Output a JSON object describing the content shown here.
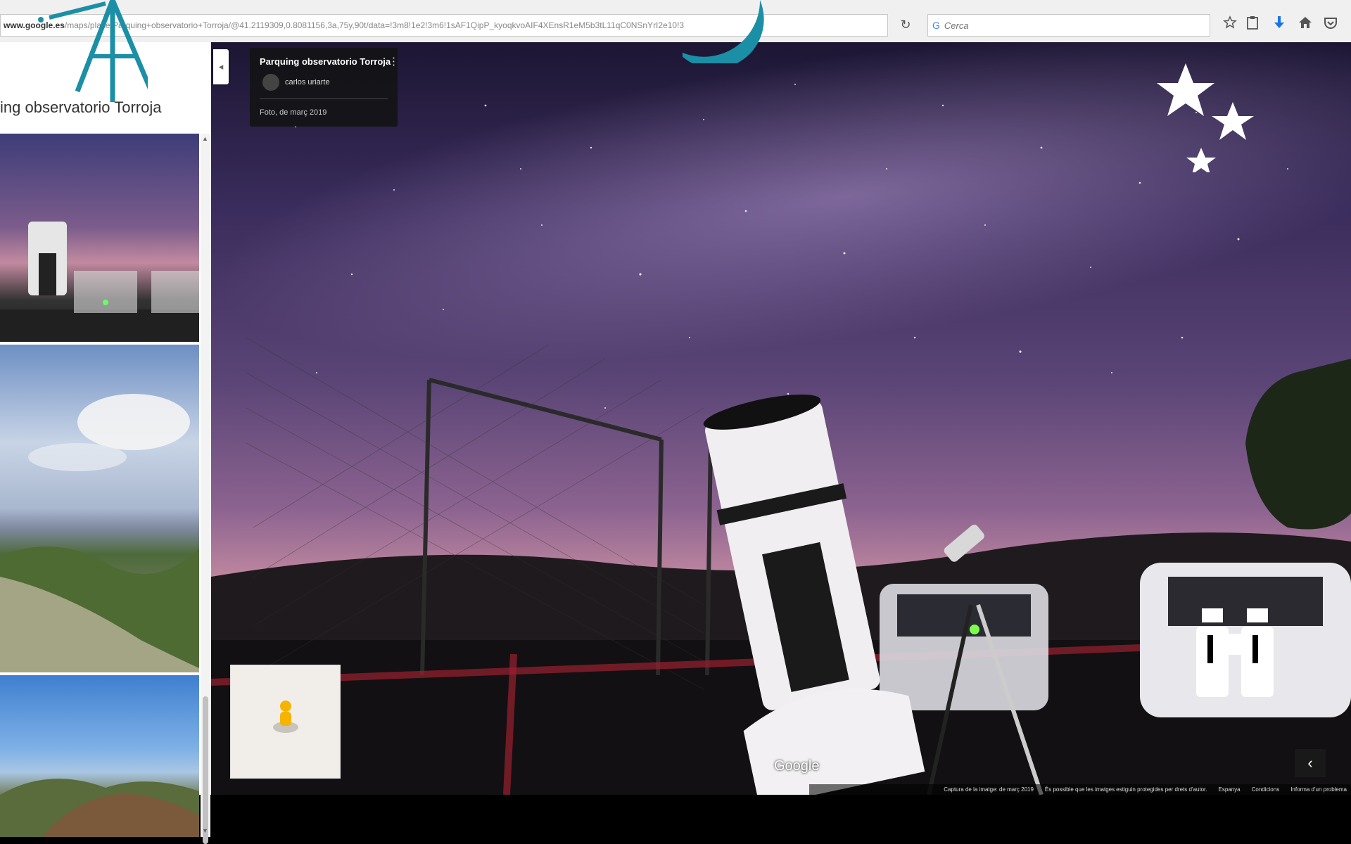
{
  "browser": {
    "url_domain": "www.google.es",
    "url_path": "/maps/place/Parquing+observatorio+Torroja/@41.2119309,0.8081156,3a,75y,90t/data=!3m8!1e2!3m6!1sAF1QipP_kyoqkvoAIF4XEnsR1eM5b3tL11qC0NSnYrI2e10!3",
    "search_placeholder": "Cerca",
    "reload_icon": "↻",
    "search_engine_icon": "G",
    "toolbar_icons": [
      "star-icon",
      "clipboard-icon",
      "download-icon",
      "home-icon",
      "pocket-icon"
    ]
  },
  "panel": {
    "place_title": "ing observatorio Torroja",
    "collapse_icon": "◂"
  },
  "viewer": {
    "info_title": "Parquing observatorio Torroja",
    "author": "carlos uriarte",
    "date": "Foto, de març 2019",
    "menu_icon": "⋮",
    "google_logo": "Google",
    "prev_icon": "‹",
    "footer": {
      "capture": "Captura de la imatge: de març 2019",
      "copyright": "És possible que les imatges estiguin protegides per drets d'autor.",
      "region": "Espanya",
      "terms": "Condicions",
      "report": "Informa d'un problema"
    }
  },
  "colors": {
    "accent_teal": "#1b8fa6",
    "sky_top": "#1c1633",
    "sky_glow": "#c38aa0"
  }
}
